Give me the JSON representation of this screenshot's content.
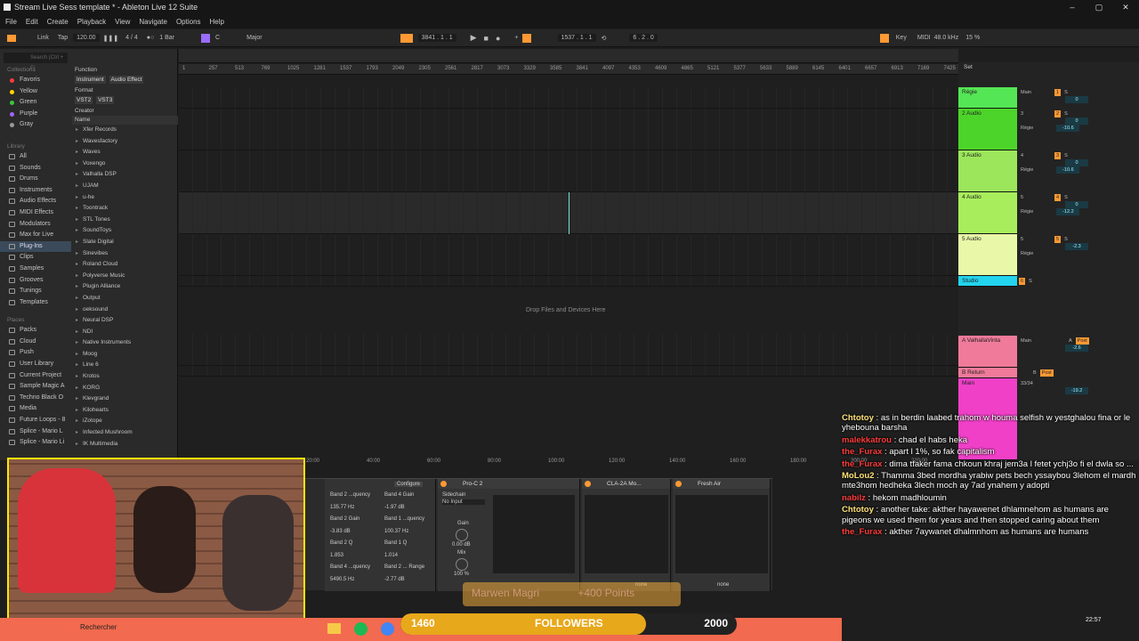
{
  "window": {
    "title": "Stream Live Sess template * - Ableton Live 12 Suite",
    "controls": [
      "–",
      "▢",
      "✕"
    ]
  },
  "menu": [
    "File",
    "Edit",
    "Create",
    "Playback",
    "View",
    "Navigate",
    "Options",
    "Help"
  ],
  "transport": {
    "link": "Link",
    "tap": "Tap",
    "tempo": "120.00",
    "signature": "4 / 4",
    "quantize": "1 Bar",
    "key": "C",
    "scale": "Major",
    "position": "3841 . 1 . 1",
    "loop_start": "1537 . 1 . 1",
    "loop_length": "6 . 2 . 0",
    "key_label": "Key",
    "midi_label": "MIDI",
    "sample_rate": "48.0 kHz",
    "cpu": "15 %"
  },
  "browser": {
    "search_placeholder": "Search (Ctrl + F)",
    "collections_label": "Collections",
    "collections": [
      {
        "label": "Favoris",
        "color": "#ff3b3b"
      },
      {
        "label": "Yellow",
        "color": "#ffd700"
      },
      {
        "label": "Green",
        "color": "#3ac93a"
      },
      {
        "label": "Purple",
        "color": "#a066ff"
      },
      {
        "label": "Gray",
        "color": "#999999"
      }
    ],
    "library_label": "Library",
    "library": [
      "All",
      "Sounds",
      "Drums",
      "Instruments",
      "Audio Effects",
      "MIDI Effects",
      "Modulators",
      "Max for Live",
      "Plug-Ins",
      "Clips",
      "Samples",
      "Grooves",
      "Tunings",
      "Templates"
    ],
    "places_label": "Places",
    "places": [
      "Packs",
      "Cloud",
      "Push",
      "User Library",
      "Current Project",
      "Sample Magic A",
      "Techno Black O",
      "Media",
      "Future Loops - 8",
      "Splice - Mario L",
      "Splice - Mario Li"
    ],
    "filters": {
      "function_label": "Function",
      "function_tags": [
        "Instrument",
        "Audio Effect"
      ],
      "format_label": "Format",
      "format_tags": [
        "VST2",
        "VST3"
      ],
      "creator_label": "Creator"
    },
    "name_header": "Name",
    "vendors": [
      "Xfer Records",
      "Wavesfactory",
      "Waves",
      "Voxengo",
      "Valhalla DSP",
      "UJAM",
      "u-he",
      "Toontrack",
      "STL Tones",
      "SoundToys",
      "Slate Digital",
      "Sinevibes",
      "Roland Cloud",
      "Polyverse Music",
      "Plugin Alliance",
      "Output",
      "oeksound",
      "Neural DSP",
      "NDI",
      "Native Instruments",
      "Moog",
      "Line 6",
      "Krotos",
      "KORG",
      "Klevgrand",
      "Kilohearts",
      "iZotope",
      "Infected Mushroom",
      "IK Multimedia"
    ]
  },
  "arrangement": {
    "ruler": [
      "1",
      "257",
      "513",
      "769",
      "1025",
      "1281",
      "1537",
      "1793",
      "2049",
      "2305",
      "2561",
      "2817",
      "3073",
      "3329",
      "3585",
      "3841",
      "4097",
      "4353",
      "4609",
      "4865",
      "5121",
      "5377",
      "5633",
      "5889",
      "6145",
      "6401",
      "6657",
      "6913",
      "7169",
      "7425"
    ],
    "bottom_ruler": [
      "20:00",
      "40:00",
      "60:00",
      "80:00",
      "100:00",
      "120:00",
      "140:00",
      "160:00",
      "180:00",
      "200:00",
      "220:00"
    ],
    "drop_text": "Drop Files and Devices Here",
    "set_label": "Set"
  },
  "mixer": {
    "tracks": [
      {
        "name": "Régie",
        "color": "#55e655",
        "input": "Main",
        "num": "1",
        "vol": "0"
      },
      {
        "name": "2 Audio",
        "color": "#4cd42a",
        "input": "3",
        "num": "2",
        "vol": "0",
        "route": "Régie",
        "gain": "-10.6"
      },
      {
        "name": "3 Audio",
        "color": "#9be65a",
        "input": "4",
        "num": "3",
        "vol": "0",
        "route": "Régie",
        "gain": "-10.6"
      },
      {
        "name": "4 Audio",
        "color": "#a8ee5c",
        "input": "5",
        "num": "4",
        "vol": "0",
        "route": "Régie",
        "gain": "-12.2"
      },
      {
        "name": "5 Audio",
        "color": "#e8f8a8",
        "input": "5",
        "num": "5",
        "vol": "-2.3",
        "route": "Régie"
      },
      {
        "name": "Studio",
        "color": "#22d4ee",
        "num": "6"
      }
    ],
    "returns": [
      {
        "name": "A ValhallaVinta",
        "color": "#f07a9a",
        "input": "Main",
        "num": "A",
        "gain": "-2.6",
        "post": "Post"
      },
      {
        "name": "B Return",
        "color": "#f07a9a",
        "num": "B",
        "post": "Post"
      },
      {
        "name": "Main",
        "color": "#f040c8",
        "io1": "33/34",
        "io2": "33/34",
        "vol": "0",
        "gain": "-19.2"
      }
    ],
    "io_labels": {
      "in": "In",
      "auto": "Auto",
      "off": "Off",
      "s": "S",
      "c": "C",
      "inf": "-∞"
    }
  },
  "devices": {
    "eq_labels": [
      "Band 2 ...quency",
      "Band 4 Gain",
      "135.77 Hz",
      "-1.97 dB",
      "Band 2 Gain",
      "Band 1 ...quency",
      "-3.83 dB",
      "100.37 Hz",
      "Band 2 Q",
      "Band 1 Q",
      "1.853",
      "1.014",
      "Band 4 ...quency",
      "Band 2 ... Range",
      "5490.5 Hz",
      "-2.77 dB"
    ],
    "configure": "Configure",
    "proc_title": "Pro-C 2",
    "sidechain": "Sidechain",
    "no_input": "No Input",
    "gain_label": "Gain",
    "gain_value": "0.00 dB",
    "mix_label": "Mix",
    "mix_value": "100 %",
    "cla_title": "CLA-2A Mo...",
    "fresh_title": "Fresh Air",
    "none": "none"
  },
  "overlay": {
    "followers_label": "FOLLOWERS",
    "followers_current": "1460",
    "followers_goal": "2000",
    "followers_progress": 0.73,
    "sub_name": "Marwen Magri",
    "sub_points": "+400 Points",
    "search": "Rechercher",
    "clock_time": "22:57"
  },
  "chat": [
    {
      "user": "Chtotoy",
      "color": "#ffe27a",
      "text": "as in berdin laabed trahom w houma selfish w yestghalou fina or le yhebouna barsha"
    },
    {
      "user": "malekkatrou",
      "color": "#ff3b3b",
      "text": "chad el habs heka"
    },
    {
      "user": "the_Furax",
      "color": "#ff3b3b",
      "text": "apart l 1%, so fak capitalism"
    },
    {
      "user": "the_Furax",
      "color": "#ff3b3b",
      "text": "dima tfaker fama chkoun khraj jem3a l fetet ychj3o fi el dwla so ..."
    },
    {
      "user": "MoLou2",
      "color": "#ffe27a",
      "text": "Thamma 3bed mordha yrabiw pets bech yssaybou 3lehom el mardh mte3hom hedheka 3lech moch ay 7ad ynahem y adopti"
    },
    {
      "user": "nabilz",
      "color": "#ff3b3b",
      "text": "hekom madhloumin"
    },
    {
      "user": "Chtotoy",
      "color": "#ffe27a",
      "text": "another take: akther hayawenet dhlamnehom as humans are pigeons we used them for years and then stopped caring about them"
    },
    {
      "user": "the_Furax",
      "color": "#ff3b3b",
      "text": "akther 7aywanet dhalmnhom as humans are humans"
    }
  ]
}
